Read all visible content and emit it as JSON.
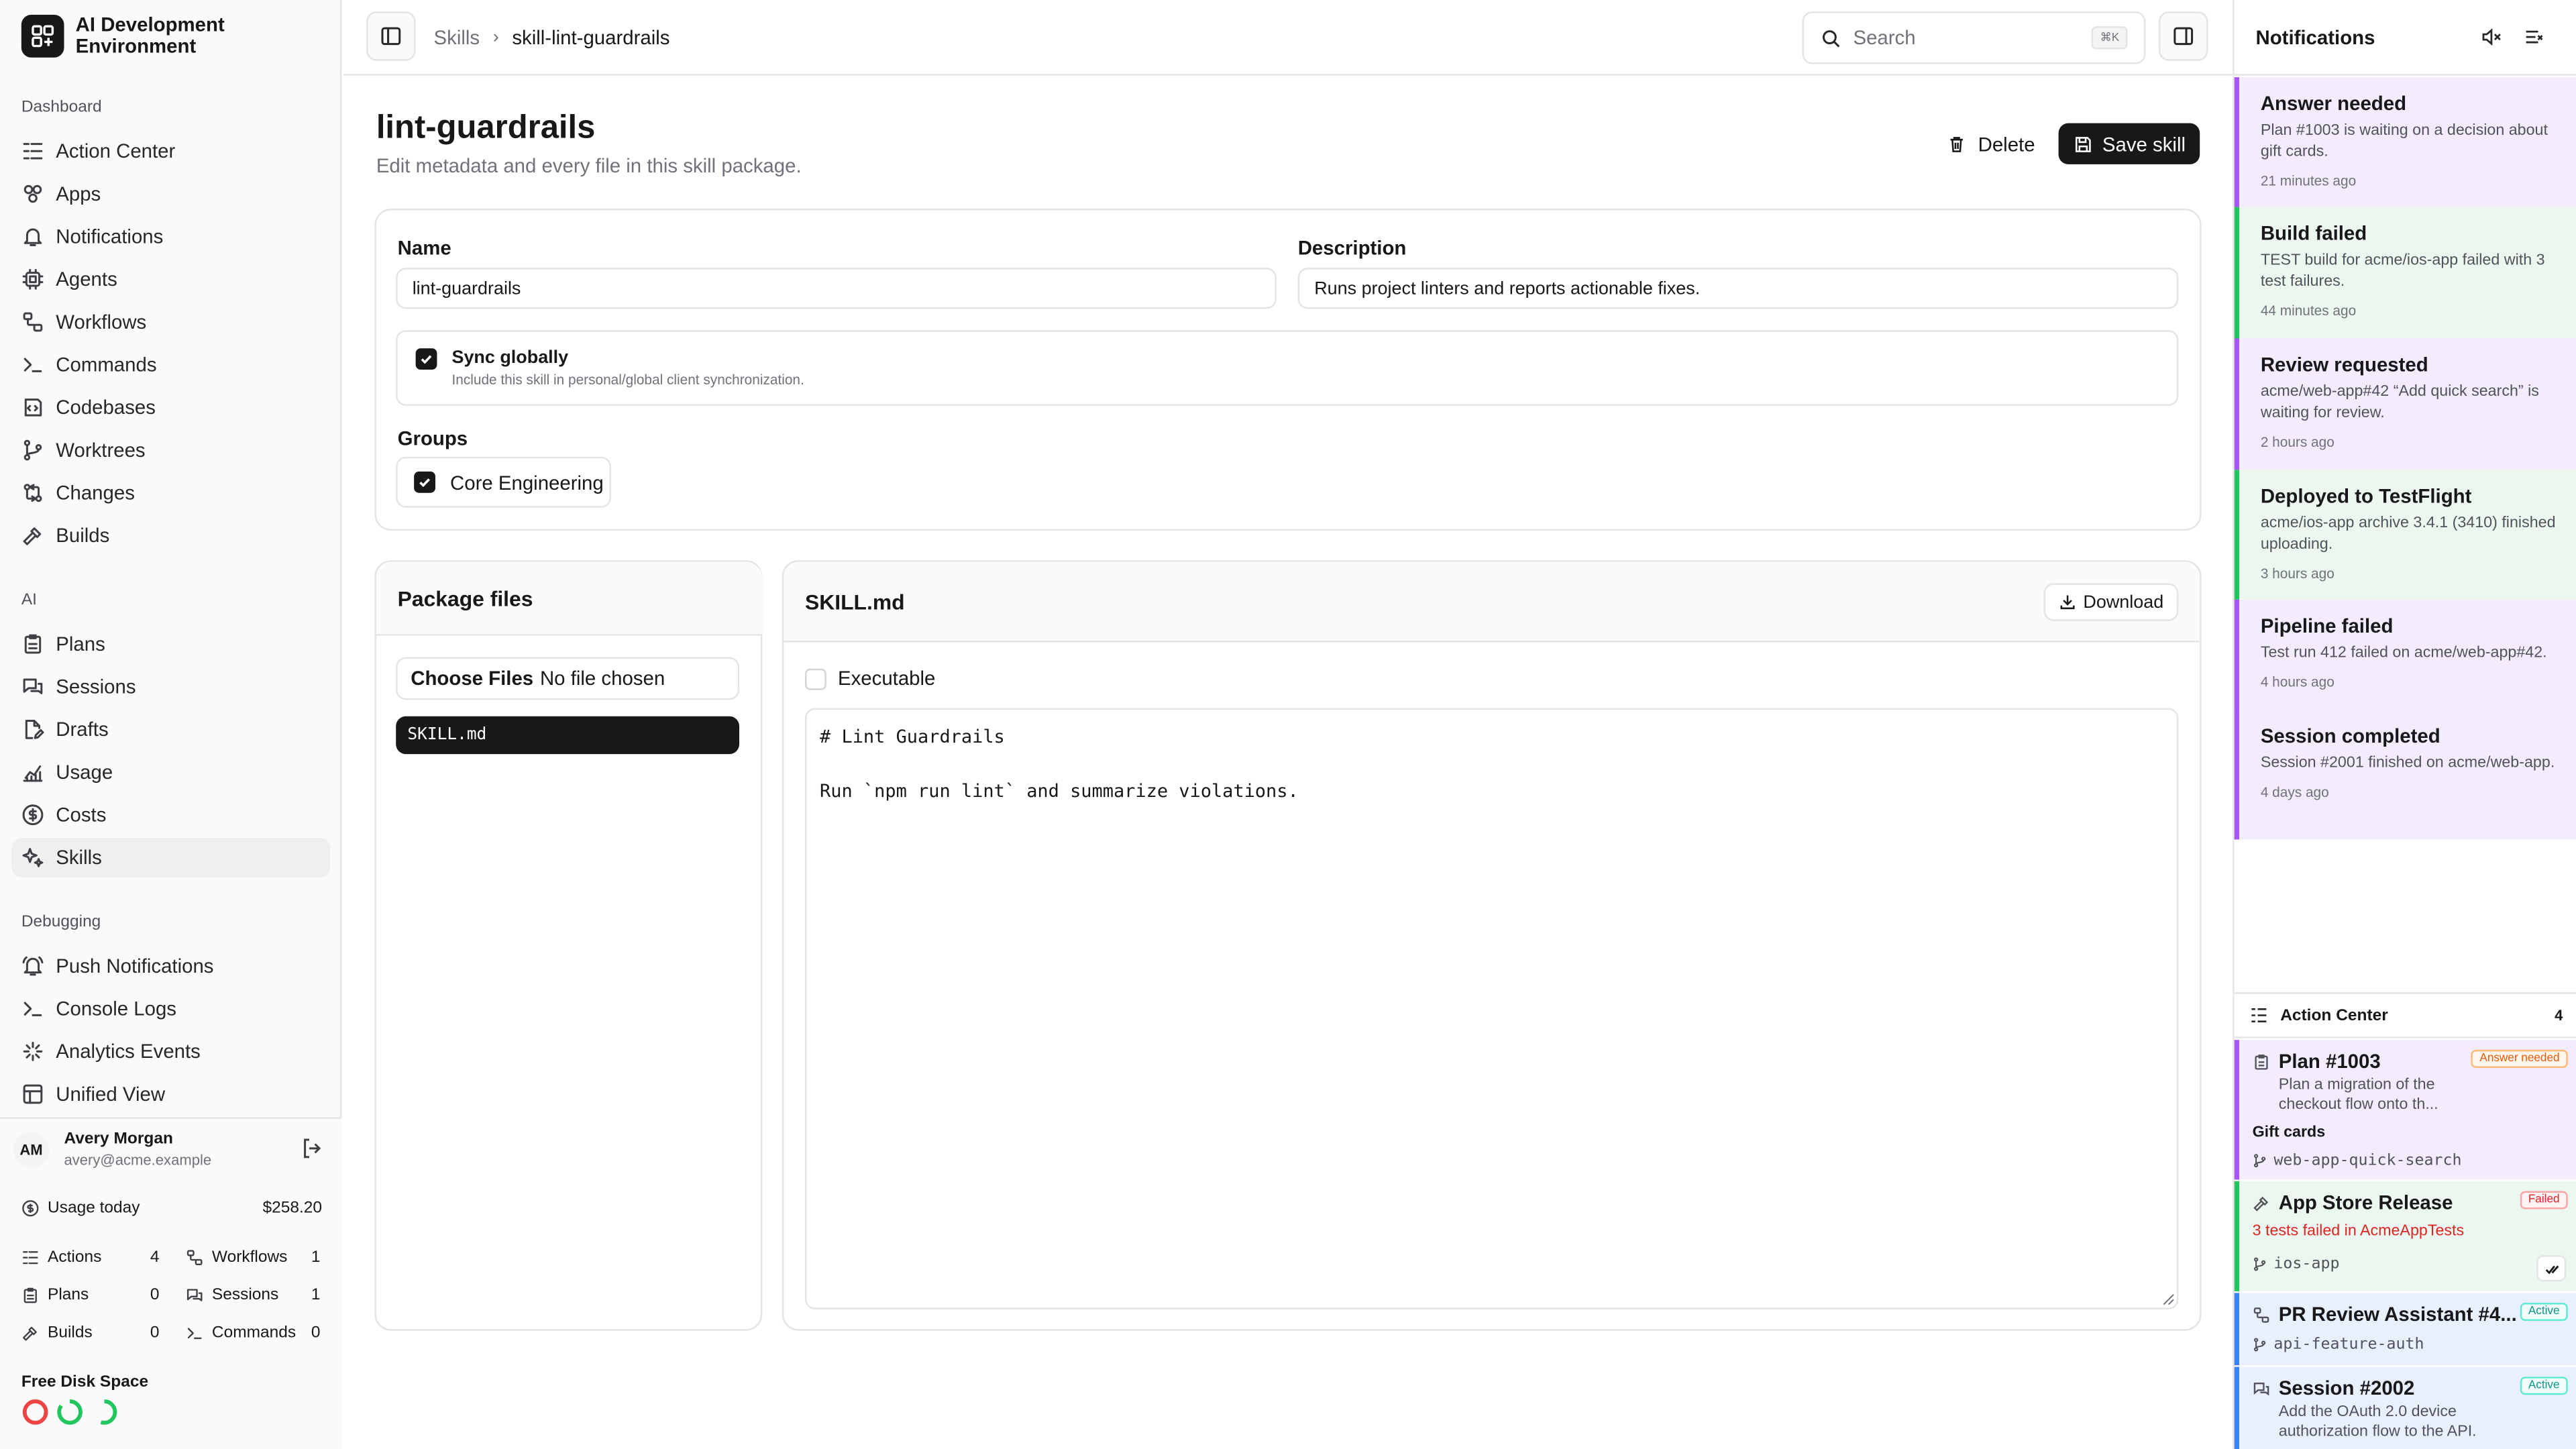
{
  "app": {
    "name": "AI Development Environment"
  },
  "sidebar": {
    "sections": [
      {
        "label": "Dashboard",
        "items": [
          {
            "label": "Action Center",
            "icon": "action-center-icon"
          },
          {
            "label": "Apps",
            "icon": "apps-icon"
          },
          {
            "label": "Notifications",
            "icon": "bell-icon"
          },
          {
            "label": "Agents",
            "icon": "agent-icon"
          },
          {
            "label": "Workflows",
            "icon": "workflow-icon"
          },
          {
            "label": "Commands",
            "icon": "terminal-icon"
          },
          {
            "label": "Codebases",
            "icon": "codebase-icon"
          },
          {
            "label": "Worktrees",
            "icon": "branch-icon"
          },
          {
            "label": "Changes",
            "icon": "changes-icon"
          },
          {
            "label": "Builds",
            "icon": "hammer-icon"
          }
        ]
      },
      {
        "label": "AI",
        "items": [
          {
            "label": "Plans",
            "icon": "clipboard-icon"
          },
          {
            "label": "Sessions",
            "icon": "chat-icon"
          },
          {
            "label": "Drafts",
            "icon": "file-edit-icon"
          },
          {
            "label": "Usage",
            "icon": "chart-icon"
          },
          {
            "label": "Costs",
            "icon": "dollar-icon"
          },
          {
            "label": "Skills",
            "icon": "sparkles-icon",
            "active": true
          }
        ]
      },
      {
        "label": "Debugging",
        "items": [
          {
            "label": "Push Notifications",
            "icon": "bell-ring-icon"
          },
          {
            "label": "Console Logs",
            "icon": "terminal-icon"
          },
          {
            "label": "Analytics Events",
            "icon": "activity-icon"
          },
          {
            "label": "Unified View",
            "icon": "layout-icon"
          }
        ]
      }
    ],
    "user": {
      "initials": "AM",
      "name": "Avery Morgan",
      "email": "avery@acme.example"
    },
    "usage": {
      "label": "Usage today",
      "value": "$258.20"
    },
    "stats": [
      {
        "label": "Actions",
        "value": "4",
        "icon": "action-center-icon"
      },
      {
        "label": "Workflows",
        "value": "1",
        "icon": "workflow-icon"
      },
      {
        "label": "Plans",
        "value": "0",
        "icon": "clipboard-icon"
      },
      {
        "label": "Sessions",
        "value": "1",
        "icon": "chat-icon"
      },
      {
        "label": "Builds",
        "value": "0",
        "icon": "hammer-icon"
      },
      {
        "label": "Commands",
        "value": "0",
        "icon": "terminal-icon"
      }
    ],
    "disk": {
      "label": "Free Disk Space",
      "colors": [
        "#ef4444",
        "#22c55e",
        "#22c55e"
      ]
    }
  },
  "header": {
    "breadcrumbs": [
      "Skills",
      "skill-lint-guardrails"
    ],
    "search_placeholder": "Search",
    "search_shortcut": "⌘K"
  },
  "page": {
    "title": "lint-guardrails",
    "subtitle": "Edit metadata and every file in this skill package.",
    "delete_label": "Delete",
    "save_label": "Save skill"
  },
  "form": {
    "name_label": "Name",
    "name_value": "lint-guardrails",
    "description_label": "Description",
    "description_value": "Runs project linters and reports actionable fixes.",
    "sync_label": "Sync globally",
    "sync_help": "Include this skill in personal/global client synchronization.",
    "sync_checked": true,
    "groups_label": "Groups",
    "groups": [
      {
        "label": "Core Engineering",
        "checked": true
      }
    ]
  },
  "files": {
    "title": "Package files",
    "choose_button": "Choose Files",
    "no_file_text": "No file chosen",
    "items": [
      "SKILL.md"
    ]
  },
  "editor": {
    "filename": "SKILL.md",
    "download_label": "Download",
    "executable_label": "Executable",
    "executable_checked": false,
    "content": "# Lint Guardrails\n\nRun `npm run lint` and summarize violations."
  },
  "notifications": {
    "title": "Notifications",
    "items": [
      {
        "title": "Answer needed",
        "desc": "Plan #1003 is waiting on a decision about gift cards.",
        "time": "21 minutes ago",
        "color": "#a855f7",
        "bg": "#f3ecfd"
      },
      {
        "title": "Build failed",
        "desc": "TEST build for acme/ios-app failed with 3 test failures.",
        "time": "44 minutes ago",
        "color": "#22c55e",
        "bg": "#ecf8ef"
      },
      {
        "title": "Review requested",
        "desc": "acme/web-app#42 “Add quick search” is waiting for review.",
        "time": "2 hours ago",
        "color": "#a855f7",
        "bg": "#f3ecfd"
      },
      {
        "title": "Deployed to TestFlight",
        "desc": "acme/ios-app archive 3.4.1 (3410) finished uploading.",
        "time": "3 hours ago",
        "color": "#22c55e",
        "bg": "#ecf8ef"
      },
      {
        "title": "Pipeline failed",
        "desc": "Test run 412 failed on acme/web-app#42.",
        "time": "4 hours ago",
        "color": "#a855f7",
        "bg": "#f3ecfd"
      },
      {
        "title": "Session completed",
        "desc": "Session #2001 finished on acme/web-app.",
        "time": "4 days ago",
        "color": "#a855f7",
        "bg": "#f3ecfd"
      }
    ]
  },
  "action_center": {
    "title": "Action Center",
    "count": "4",
    "cards": [
      {
        "title": "Plan #1003",
        "badge": "Answer needed",
        "desc": "Plan a migration of the checkout flow onto th...",
        "extra": "Gift cards",
        "branch": "web-app-quick-search",
        "icon": "clipboard-icon"
      },
      {
        "title": "App Store Release",
        "badge": "Failed",
        "error": "3 tests failed in AcmeAppTests",
        "branch": "ios-app",
        "icon": "hammer-icon"
      },
      {
        "title": "PR Review Assistant #4...",
        "badge": "Active",
        "branch": "api-feature-auth",
        "icon": "workflow-icon"
      },
      {
        "title": "Session #2002",
        "badge": "Active",
        "desc": "Add the OAuth 2.0 device authorization flow to the API.",
        "icon": "chat-icon"
      }
    ]
  }
}
